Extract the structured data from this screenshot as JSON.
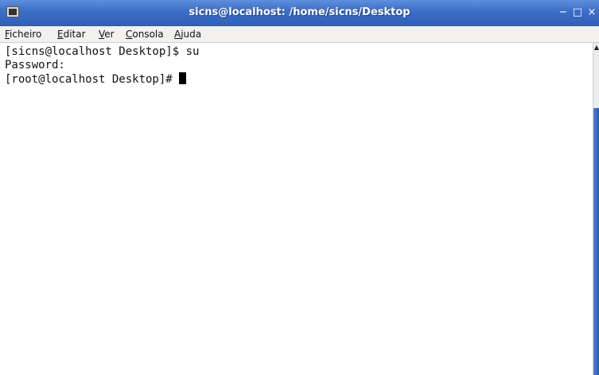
{
  "window": {
    "title": "sicns@localhost: /home/sicns/Desktop",
    "controls": {
      "minimize": "−",
      "maximize": "□",
      "close": "×"
    }
  },
  "menu": {
    "items": [
      {
        "label_ul": "F",
        "label_rest": "icheiro"
      },
      {
        "label_ul": "E",
        "label_rest": "ditar"
      },
      {
        "label_ul": "V",
        "label_rest": "er"
      },
      {
        "label_ul": "C",
        "label_rest": "onsola"
      },
      {
        "label_ul": "A",
        "label_rest": "juda"
      }
    ]
  },
  "terminal": {
    "lines": [
      "[sicns@localhost Desktop]$ su",
      "Password:",
      "[root@localhost Desktop]# "
    ]
  },
  "scrollbar": {
    "up_arrow": "▲"
  },
  "colors": {
    "titlebar": "#3d6fc7",
    "scroll_thumb": "#3a6ac2"
  }
}
